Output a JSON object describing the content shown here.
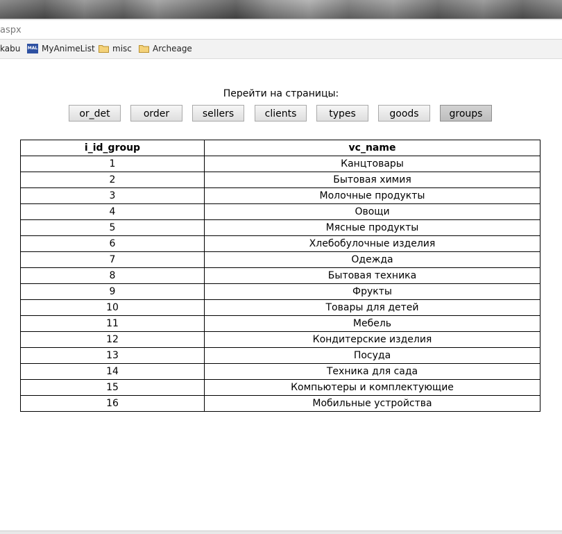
{
  "browser": {
    "address_text": "aspx",
    "bookmarks": [
      {
        "label": "kabu",
        "icon": "none"
      },
      {
        "label": "MyAnimeList",
        "icon": "mal-icon"
      },
      {
        "label": "misc",
        "icon": "folder-icon"
      },
      {
        "label": "Archeage",
        "icon": "folder-icon"
      }
    ]
  },
  "nav": {
    "heading": "Перейти на страницы:",
    "buttons": [
      {
        "label": "or_det",
        "active": false
      },
      {
        "label": "order",
        "active": false
      },
      {
        "label": "sellers",
        "active": false
      },
      {
        "label": "clients",
        "active": false
      },
      {
        "label": "types",
        "active": false
      },
      {
        "label": "goods",
        "active": false
      },
      {
        "label": "groups",
        "active": true
      }
    ]
  },
  "table": {
    "headers": [
      "i_id_group",
      "vc_name"
    ],
    "rows": [
      [
        "1",
        "Канцтовары"
      ],
      [
        "2",
        "Бытовая химия"
      ],
      [
        "3",
        "Молочные продукты"
      ],
      [
        "4",
        "Овощи"
      ],
      [
        "5",
        "Мясные продукты"
      ],
      [
        "6",
        "Хлебобулочные изделия"
      ],
      [
        "7",
        "Одежда"
      ],
      [
        "8",
        "Бытовая техника"
      ],
      [
        "9",
        "Фрукты"
      ],
      [
        "10",
        "Товары для детей"
      ],
      [
        "11",
        "Мебель"
      ],
      [
        "12",
        "Кондитерские изделия"
      ],
      [
        "13",
        "Посуда"
      ],
      [
        "14",
        "Техника для сада"
      ],
      [
        "15",
        "Компьютеры и комплектующие"
      ],
      [
        "16",
        "Мобильные устройства"
      ]
    ]
  }
}
